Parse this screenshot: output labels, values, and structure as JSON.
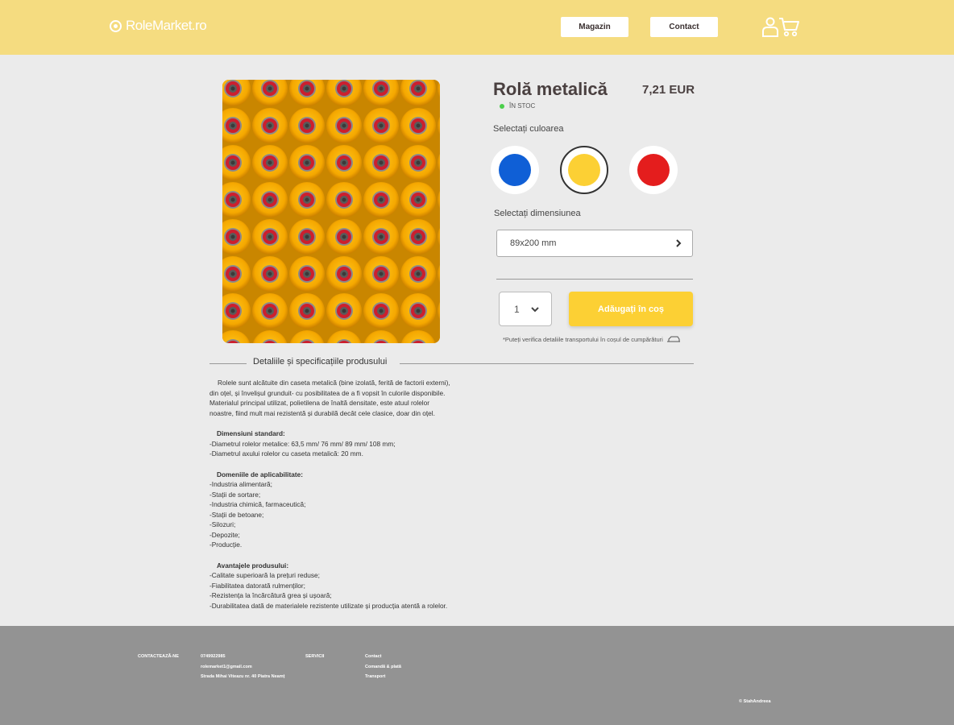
{
  "header": {
    "logo": "RoleMarket.ro",
    "nav": {
      "magazin": "Magazin",
      "contact": "Contact"
    },
    "icons": [
      "user-icon",
      "cart-icon"
    ],
    "bg_color": "#f5dc80"
  },
  "product": {
    "title": "Rolă metalică",
    "price": "7,21 EUR",
    "stock": "ÎN STOC",
    "color_label": "Selectați culoarea",
    "colors": [
      "#0f5fd6",
      "#fcd034",
      "#e41d1d"
    ],
    "selected_color": "#fcd034",
    "size_label": "Selectați dimensiunea",
    "size_value": "89x200 mm",
    "quantity": "1",
    "add_to_cart": "Adăugați în coș",
    "transport_note": "*Puteți verifica detaliile transportului în coșul de cumpărături"
  },
  "details": {
    "title": "Detaliile și specificațiile produsului",
    "intro": "Rolele sunt alcătuite din caseta metalică (bine izolată, ferită de factorii externi), din oțel, și învelișul grunduit- cu posibilitatea de a fi vopsit în culorile disponibile. Materialul principal utilizat, polietilena de înaltă densitate, este atuul rolelor noastre, fiind mult mai rezistentă și durabilă decât cele clasice, doar din oțel.",
    "dims_heading": "Dimensiuni standard:",
    "dims": [
      "-Diametrul rolelor metalice: 63,5 mm/ 76 mm/ 89 mm/ 108 mm;",
      "-Diametrul axului rolelor cu caseta metalică: 20 mm."
    ],
    "domains_heading": "Domeniile de aplicabilitate:",
    "domains": [
      "-Industria alimentară;",
      "-Stații de sortare;",
      "-Industria chimică, farmaceutică;",
      "-Stații de betoane;",
      "-Silozuri;",
      "-Depozite;",
      "-Producție."
    ],
    "advantages_heading": "Avantajele produsului:",
    "advantages": [
      "-Calitate superioară la prețuri reduse;",
      "-Fiabilitatea datorată rulmenților;",
      "-Rezistența la încărcătură grea și ușoară;",
      "-Durabilitatea dată de materialele rezistente utilizate și producția atentă a rolelor."
    ]
  },
  "footer": {
    "contact_label": "CONTACTEAZĂ-NE",
    "phone": "0749922985",
    "email": "rolemarket1@gmail.com",
    "address": "Strada Mihai Viteazu nr. 40 Piatra Neamț",
    "services_label": "SERVICII",
    "links": [
      "Contact",
      "Comandă & plată",
      "Transport"
    ],
    "copyright": "© StahAndreea"
  }
}
